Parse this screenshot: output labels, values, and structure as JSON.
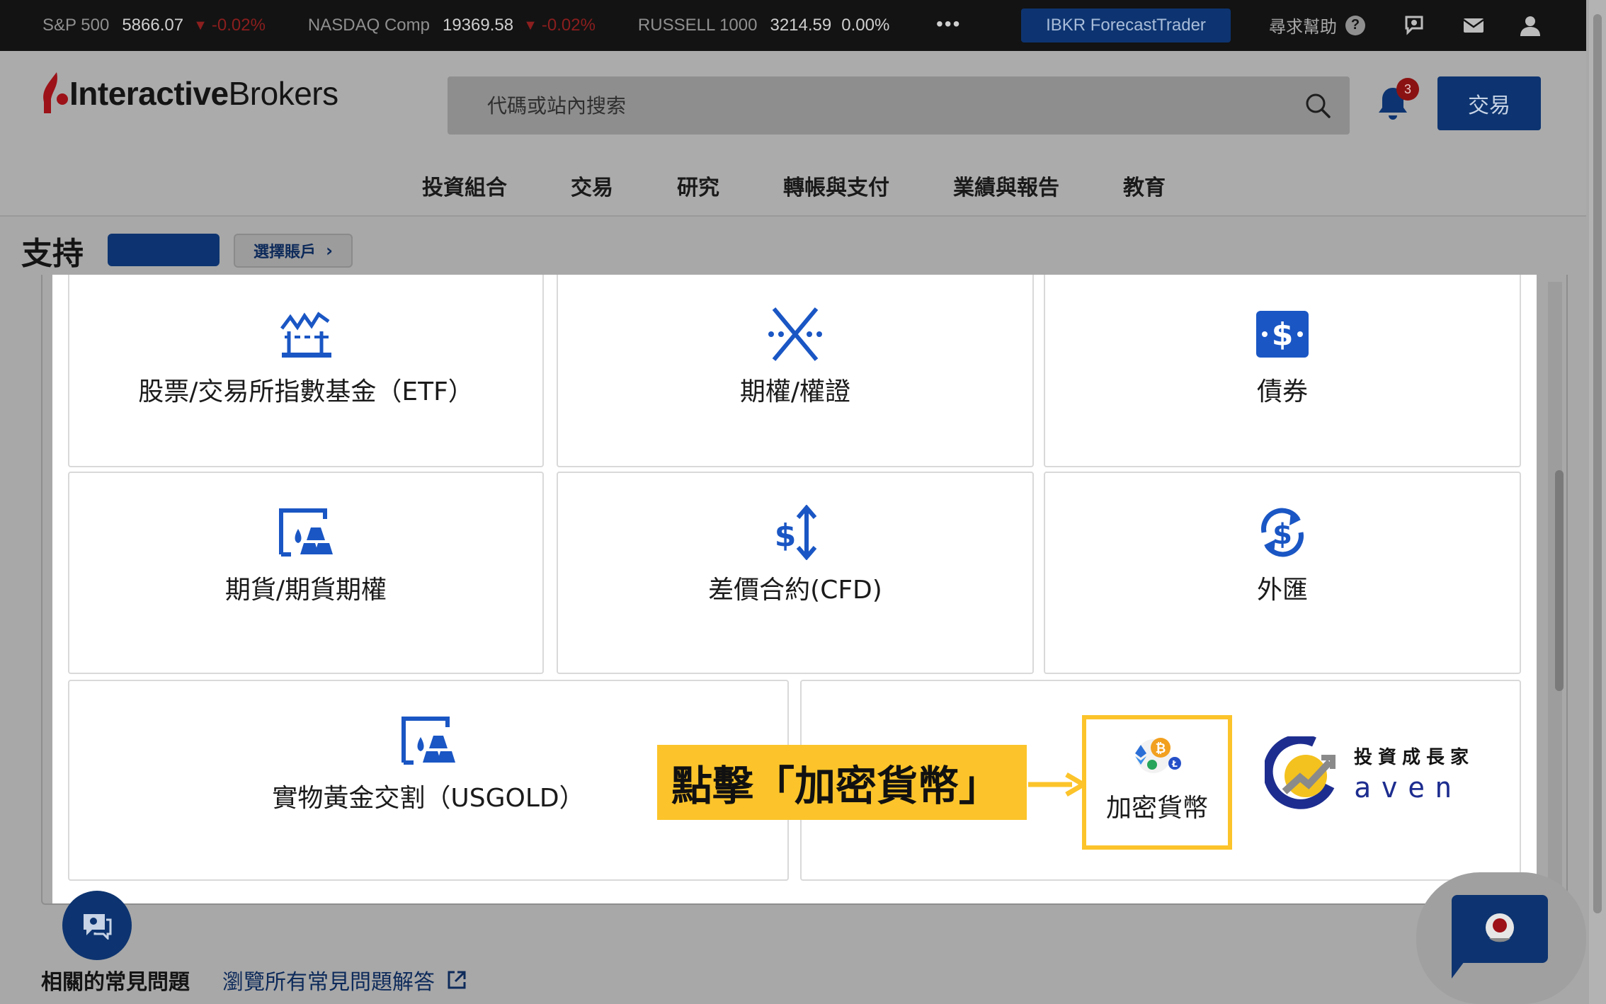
{
  "ticker": [
    {
      "name": "S&P 500",
      "value": "5866.07",
      "change": "-0.02%",
      "direction": "down"
    },
    {
      "name": "NASDAQ Comp",
      "value": "19369.58",
      "change": "-0.02%",
      "direction": "down"
    },
    {
      "name": "RUSSELL 1000",
      "value": "3214.59",
      "change": "0.00%",
      "direction": "flat"
    }
  ],
  "topbar": {
    "more": "•••",
    "forecast_button": "IBKR ForecastTrader",
    "help_label": "尋求幫助",
    "help_icon": "?"
  },
  "header": {
    "logo_part1": "Interactive",
    "logo_part2": "Brokers",
    "search_placeholder": "代碼或站內搜索",
    "notification_count": "3",
    "trade_button": "交易",
    "nav": [
      "投資組合",
      "交易",
      "研究",
      "轉帳與支付",
      "業績與報告",
      "教育"
    ]
  },
  "support": {
    "title": "支持",
    "select_account": "選擇賬戶"
  },
  "modal": {
    "cards": [
      {
        "label": "股票/交易所指數基金（ETF）",
        "icon": "stocks-etf-icon"
      },
      {
        "label": "期權/權證",
        "icon": "options-icon"
      },
      {
        "label": "債券",
        "icon": "bonds-icon"
      },
      {
        "label": "期貨/期貨期權",
        "icon": "futures-icon"
      },
      {
        "label": "差價合約(CFD)",
        "icon": "cfd-icon"
      },
      {
        "label": "外匯",
        "icon": "forex-icon"
      },
      {
        "label": "實物黃金交割（USGOLD）",
        "icon": "gold-icon"
      },
      {
        "label": "加密貨幣",
        "icon": "crypto-icon"
      }
    ]
  },
  "annotation": {
    "callout": "點擊「加密貨幣」",
    "brand_cn": "投資成長家",
    "brand_en": "aven"
  },
  "footer": {
    "faq_title": "相關的常見問題",
    "faq_link": "瀏覽所有常見問題解答"
  },
  "colors": {
    "brand_navy": "#0d3470",
    "icon_blue": "#1a56c4",
    "highlight_yellow": "#fcc42a",
    "ticker_down": "#8b1e1e",
    "logo_red": "#b5121b"
  }
}
